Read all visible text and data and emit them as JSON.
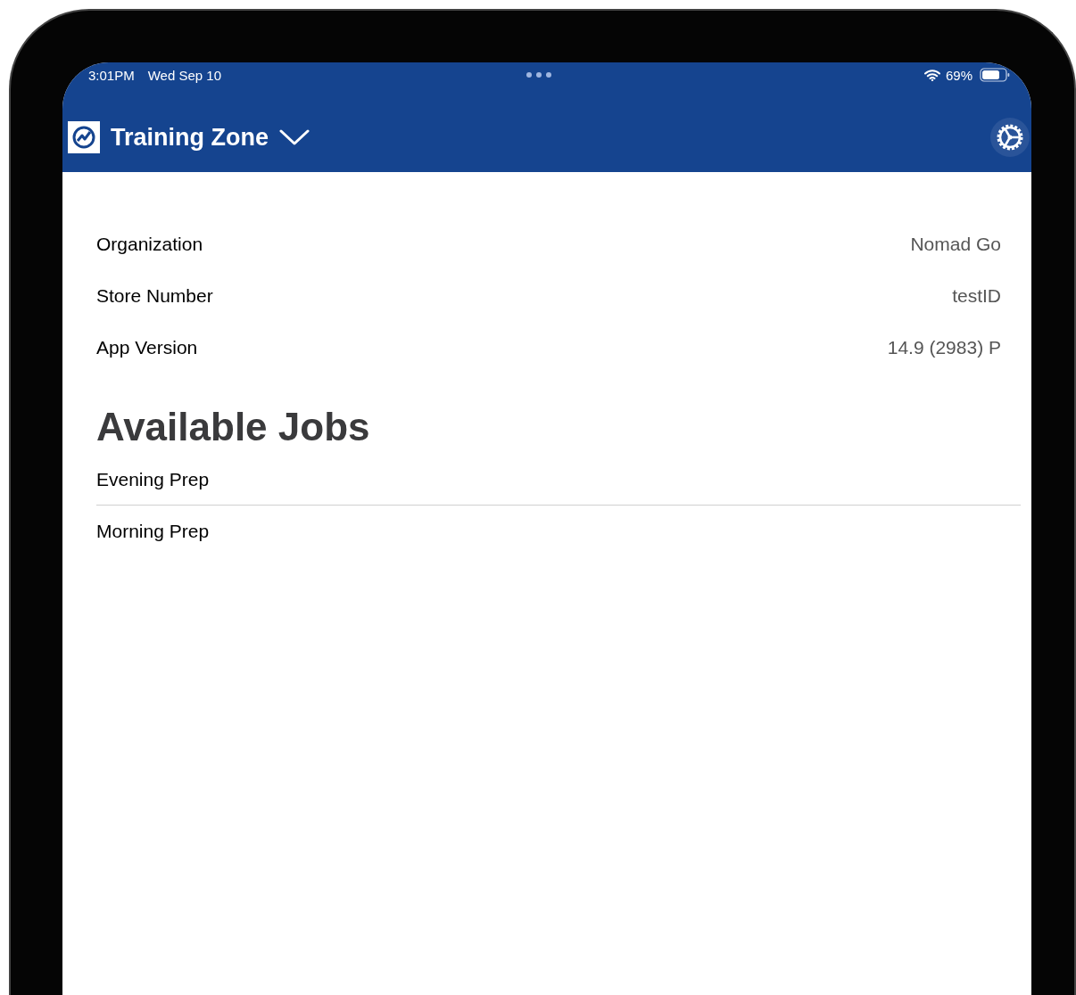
{
  "status_bar": {
    "time": "3:01PM",
    "date": "Wed Sep 10",
    "battery": "69%"
  },
  "header": {
    "title": "Training Zone"
  },
  "info": [
    {
      "label": "Organization",
      "value": "Nomad Go"
    },
    {
      "label": "Store Number",
      "value": "testID"
    },
    {
      "label": "App Version",
      "value": "14.9 (2983) P"
    }
  ],
  "jobs": {
    "title": "Available Jobs",
    "items": [
      "Evening Prep",
      "Morning Prep"
    ]
  }
}
